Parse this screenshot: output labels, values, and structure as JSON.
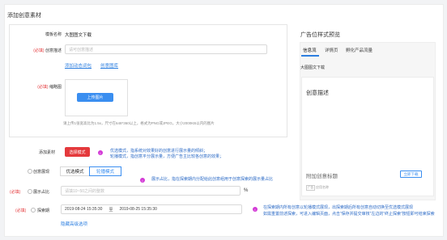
{
  "page": {
    "title": "添加创意素材"
  },
  "form": {
    "template_label": "模板名称",
    "template_value": "大图图文下载",
    "desc_required": "(必填)",
    "desc_label": "创意描述",
    "desc_placeholder": "请可创意描述",
    "link_add_words": "添加动态词包",
    "link_lib": "创意图库",
    "thumb_required": "(必填)",
    "thumb_label": "缩略图",
    "upload_button": "上传图片",
    "upload_hint": "请上传1张宽高比为1.5x，尺寸在648*360以上，格式为PNG或JPEG，大小2000KB以内的图片"
  },
  "material": {
    "label": "添加素材",
    "button": "选择模式",
    "tip_badge": "i",
    "tip_line1": "优选模式，指系统对效果好的创意进行展示量的倾斜；",
    "tip_line2": "轮播模式，指创意平分展示量，方便广告主比较各创意的效果；"
  },
  "display": {
    "label": "创意展现",
    "options": [
      "优选模式",
      "轮播模式"
    ],
    "selected": "轮播模式",
    "tip_badge": "i",
    "tip": "展示占比，指在探索期内分配给此创意组用于创意探索的展示量占比"
  },
  "ratio": {
    "required": "(必填)",
    "label": "展示占比",
    "placeholder": "请填10~50之间的整数",
    "unit": "%"
  },
  "explore": {
    "required": "(必填)",
    "label": "探索期",
    "start": "2019-08-24 15:35:30",
    "separator": "至",
    "end": "2019-08-25 15:35:30",
    "tip_badge": "i",
    "tip_line1": "在探索期内所有创意以轮播模式展现，出探索期后所有创意自动切换至优选模式展现",
    "tip_line2": "如需重置前述探索，可进入编辑页面，点击“保存并提交审核”左边的“终止探索”按钮即可结束探索"
  },
  "advanced_link": "隐藏高级选项",
  "preview": {
    "title": "广告位样式预览",
    "tabs": [
      "信息流",
      "详情页",
      "孵化产品流量"
    ],
    "active_tab": "信息流",
    "template": "大图图文下载",
    "card_desc": "创意描述",
    "card_title": "附加创意标题",
    "cta": "立即下载",
    "ad_tag": "广告",
    "source": "应用名称"
  }
}
